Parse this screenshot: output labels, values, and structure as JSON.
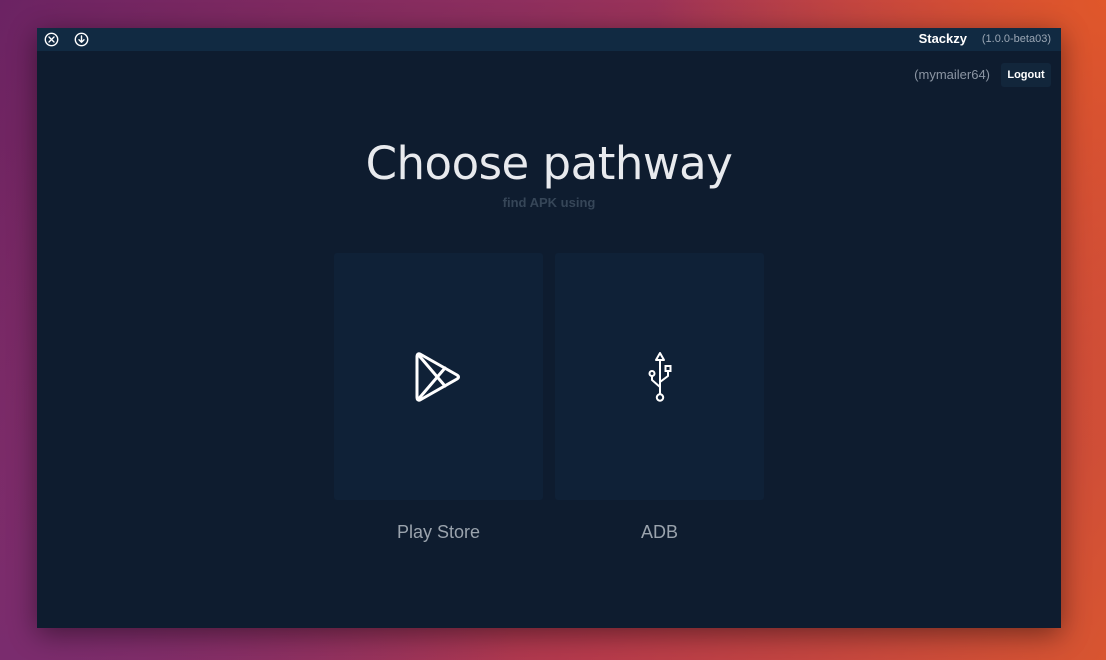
{
  "app": {
    "name": "Stackzy",
    "version": "(1.0.0-beta03)"
  },
  "window_controls": {
    "close_icon": "close-circle-icon",
    "download_icon": "download-circle-icon"
  },
  "account": {
    "username": "(mymailer64)",
    "logout_label": "Logout"
  },
  "main": {
    "title": "Choose pathway",
    "subtitle": "find APK using",
    "options": [
      {
        "label": "Play Store",
        "icon": "play-store-icon"
      },
      {
        "label": "ADB",
        "icon": "usb-icon"
      }
    ]
  },
  "colors": {
    "window_bg": "#0e1c2f",
    "titlebar_bg": "#112a42",
    "card_bg": "#0f2137",
    "title_text": "#e8eaee",
    "subtitle_text": "#364658",
    "label_text": "#9aa3ad"
  }
}
